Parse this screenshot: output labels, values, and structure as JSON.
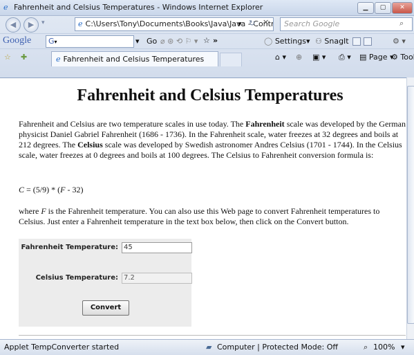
{
  "window": {
    "title": "Fahrenheit and Celsius Temperatures - Windows Internet Explorer"
  },
  "address_bar": {
    "url": "C:\\Users\\Tony\\Documents\\Books\\Java\\Java - Contro",
    "search_placeholder": "Search Google"
  },
  "google_toolbar": {
    "logo": "Google",
    "g_label": "G",
    "go_label": "Go",
    "settings_label": "Settings",
    "snagit_label": "SnagIt"
  },
  "tab": {
    "label": "Fahrenheit and Celsius Temperatures",
    "page_label": "Page",
    "tools_label": "Tools"
  },
  "page": {
    "heading": "Fahrenheit and Celsius Temperatures",
    "para1": [
      "Fahrenheit and Celsius are two temperature scales in use today. The ",
      "Fahrenheit",
      " scale was developed by the German physicist Daniel Gabriel Fahrenheit (1686 - 1736). In the Fahrenheit scale, water freezes at 32 degrees and boils at 212 degrees. The ",
      "Celsius",
      " scale was developed by Swedish astronomer Andres Celsius (1701 - 1744). In the Celsius scale, water freezes at 0 degrees and boils at 100 degrees. The Celsius to Fahrenheit conversion formula is:"
    ],
    "formula": [
      "C",
      " = (5/9) * (",
      "F",
      " - 32)"
    ],
    "para2": [
      "where ",
      "F",
      " is the Fahrenheit temperature. You can also use this Web page to convert Fahrenheit temperatures to Celsius. Just enter a Fahrenheit temperature in the text box below, then click on the Convert button."
    ]
  },
  "applet": {
    "fahrenheit_label": "Fahrenheit Temperature:",
    "fahrenheit_value": "45",
    "celsius_label": "Celsius Temperature:",
    "celsius_value": "7.2",
    "convert_label": "Convert"
  },
  "status_bar": {
    "message": "Applet TempConverter started",
    "zone": "Computer | Protected Mode: Off",
    "zoom": "100%"
  }
}
